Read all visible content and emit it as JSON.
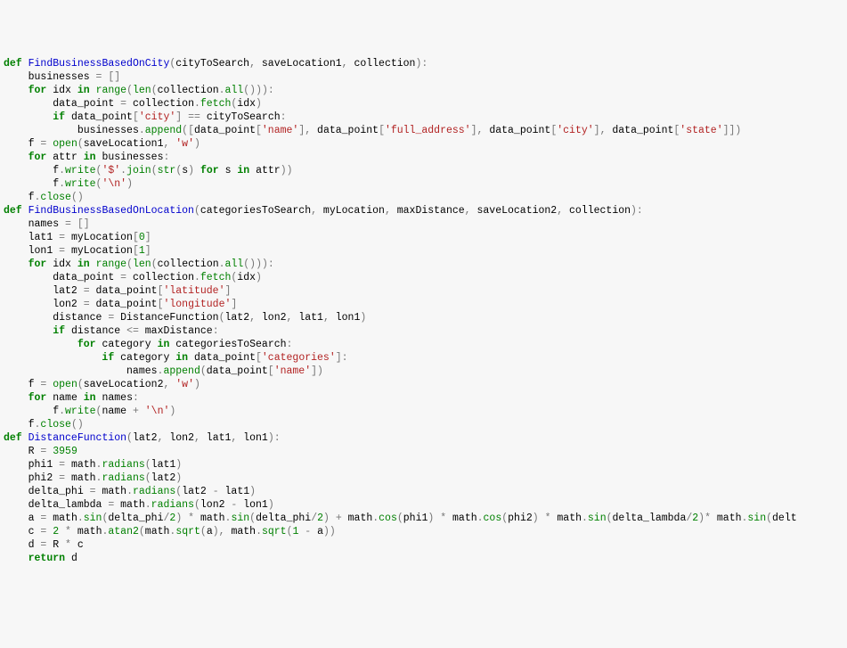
{
  "code": {
    "functions": [
      {
        "name": "FindBusinessBasedOnCity",
        "params": "cityToSearch, saveLocation1, collection",
        "body": [
          "",
          "    businesses = []",
          "    for idx in range(len(collection.all())):",
          "        data_point = collection.fetch(idx)",
          "",
          "        if data_point['city'] == cityToSearch:",
          "            businesses.append([data_point['name'], data_point['full_address'], data_point['city'], data_point['state']])",
          "",
          "    f = open(saveLocation1, 'w')",
          "    for attr in businesses:",
          "        f.write('$'.join(str(s) for s in attr))",
          "        f.write('\\n')",
          "    f.close()"
        ]
      },
      {
        "name": "FindBusinessBasedOnLocation",
        "params": "categoriesToSearch, myLocation, maxDistance, saveLocation2, collection",
        "body": [
          "    names = []",
          "    lat1 = myLocation[0]",
          "    lon1 = myLocation[1]",
          "",
          "    for idx in range(len(collection.all())):",
          "        data_point = collection.fetch(idx)",
          "        lat2 = data_point['latitude']",
          "        lon2 = data_point['longitude']",
          "",
          "        distance = DistanceFunction(lat2, lon2, lat1, lon1)",
          "        if distance <= maxDistance:",
          "            for category in categoriesToSearch:",
          "                if category in data_point['categories']:",
          "                    names.append(data_point['name'])",
          "",
          "    f = open(saveLocation2, 'w')",
          "    for name in names:",
          "        f.write(name + '\\n')",
          "    f.close()"
        ]
      },
      {
        "name": "DistanceFunction",
        "params": "lat2, lon2, lat1, lon1",
        "body": [
          "",
          "    R = 3959",
          "    phi1 = math.radians(lat1)",
          "    phi2 = math.radians(lat2)",
          "    delta_phi = math.radians(lat2 - lat1)",
          "    delta_lambda = math.radians(lon2 - lon1)",
          "    a = math.sin(delta_phi/2) * math.sin(delta_phi/2) + math.cos(phi1) * math.cos(phi2) * math.sin(delta_lambda/2)* math.sin(delt",
          "    c = 2 * math.atan2(math.sqrt(a), math.sqrt(1 - a))",
          "    d = R * c",
          "    return d"
        ]
      }
    ]
  },
  "chart_data": null
}
